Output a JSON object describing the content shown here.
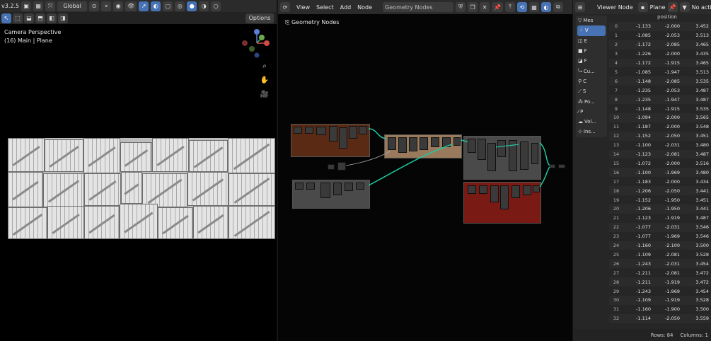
{
  "viewport": {
    "version": "v3.2.5",
    "orientation": "Global",
    "options_label": "Options",
    "view_title": "Camera Perspective",
    "view_subtitle": "(16) Main | Plane",
    "gizmo_axes": [
      "x",
      "y",
      "z"
    ]
  },
  "node_editor": {
    "menus": [
      "View",
      "Select",
      "Add",
      "Node"
    ],
    "tree_name": "Geometry Nodes",
    "breadcrumb": "Geometry Nodes"
  },
  "spreadsheet": {
    "viewer_node": "Viewer Node",
    "object": "Plane",
    "active_label": "No activ",
    "column_header": "position",
    "sidebar": [
      "Mes",
      "V",
      "E",
      "F",
      "F",
      "Cu...",
      "C",
      "S",
      "Po...",
      "P",
      "Vol...",
      "Ins..."
    ],
    "rows": [
      [
        "0",
        "-1.133",
        "-2.000",
        "3.452"
      ],
      [
        "1",
        "-1.085",
        "-2.053",
        "3.513"
      ],
      [
        "2",
        "-1.172",
        "-2.085",
        "3.465"
      ],
      [
        "3",
        "-1.226",
        "-2.000",
        "3.435"
      ],
      [
        "4",
        "-1.172",
        "-1.915",
        "3.465"
      ],
      [
        "5",
        "-1.085",
        "-1.947",
        "3.513"
      ],
      [
        "6",
        "-1.148",
        "-2.085",
        "3.535"
      ],
      [
        "7",
        "-1.235",
        "-2.053",
        "3.487"
      ],
      [
        "8",
        "-1.235",
        "-1.947",
        "3.487"
      ],
      [
        "9",
        "-1.148",
        "-1.915",
        "3.535"
      ],
      [
        "10",
        "-1.094",
        "-2.000",
        "3.565"
      ],
      [
        "11",
        "-1.187",
        "-2.000",
        "3.548"
      ],
      [
        "12",
        "-1.152",
        "-2.050",
        "3.451"
      ],
      [
        "13",
        "-1.100",
        "-2.031",
        "3.480"
      ],
      [
        "14",
        "-1.123",
        "-2.081",
        "3.487"
      ],
      [
        "15",
        "-1.072",
        "-2.000",
        "3.516"
      ],
      [
        "16",
        "-1.100",
        "-1.969",
        "3.480"
      ],
      [
        "17",
        "-1.183",
        "-2.000",
        "3.434"
      ],
      [
        "18",
        "-1.206",
        "-2.050",
        "3.441"
      ],
      [
        "19",
        "-1.152",
        "-1.950",
        "3.451"
      ],
      [
        "20",
        "-1.206",
        "-1.950",
        "3.441"
      ],
      [
        "21",
        "-1.123",
        "-1.919",
        "3.487"
      ],
      [
        "22",
        "-1.077",
        "-2.031",
        "3.546"
      ],
      [
        "23",
        "-1.077",
        "-1.969",
        "3.546"
      ],
      [
        "24",
        "-1.160",
        "-2.100",
        "3.500"
      ],
      [
        "25",
        "-1.109",
        "-2.081",
        "3.528"
      ],
      [
        "26",
        "-1.243",
        "-2.031",
        "3.454"
      ],
      [
        "27",
        "-1.211",
        "-2.081",
        "3.472"
      ],
      [
        "28",
        "-1.211",
        "-1.919",
        "3.472"
      ],
      [
        "29",
        "-1.243",
        "-1.969",
        "3.454"
      ],
      [
        "30",
        "-1.109",
        "-1.919",
        "3.528"
      ],
      [
        "31",
        "-1.160",
        "-1.900",
        "3.500"
      ],
      [
        "32",
        "-1.114",
        "-2.050",
        "3.559"
      ]
    ],
    "rows_count": "Rows: 84",
    "columns_count": "Columns: 1"
  },
  "colors": {
    "accent": "#4772b3",
    "link": "#1fc8a0",
    "frame_brown": "#5a2a14",
    "frame_tan": "#9a7a5c",
    "frame_red": "#7a1a14",
    "frame_grey": "#4a4a4a"
  }
}
